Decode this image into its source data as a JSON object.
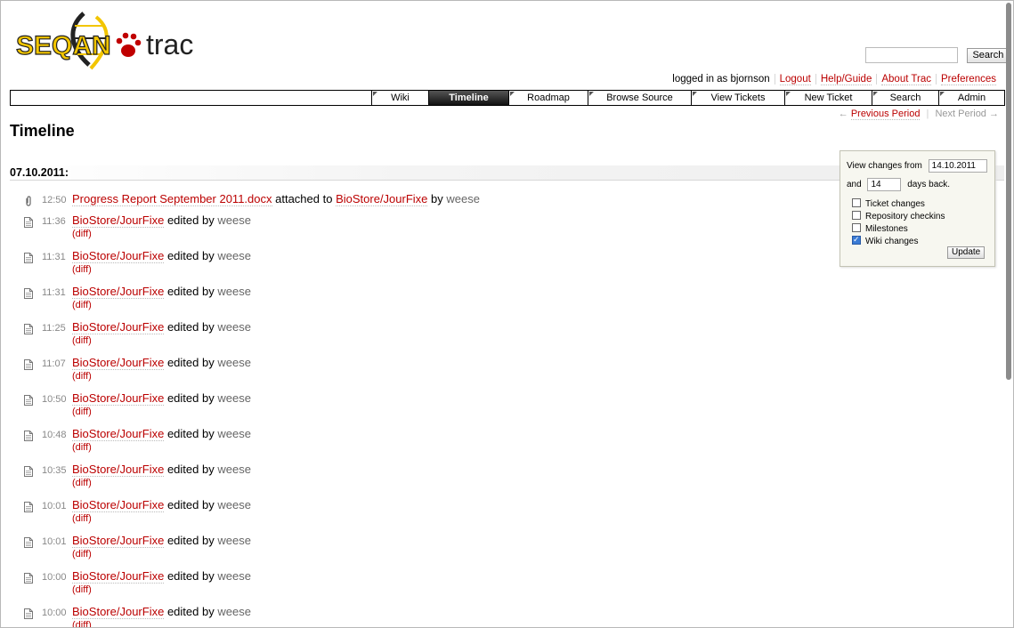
{
  "logo": {
    "text_left": "SEQAN",
    "text_right": "trac"
  },
  "search": {
    "placeholder": "",
    "button_label": "Search"
  },
  "metanav": {
    "logged_in": "logged in as bjornson",
    "items": [
      "Logout",
      "Help/Guide",
      "About Trac",
      "Preferences"
    ]
  },
  "mainnav": {
    "tabs": [
      {
        "label": "Wiki",
        "active": false
      },
      {
        "label": "Timeline",
        "active": true
      },
      {
        "label": "Roadmap",
        "active": false
      },
      {
        "label": "Browse Source",
        "active": false
      },
      {
        "label": "View Tickets",
        "active": false
      },
      {
        "label": "New Ticket",
        "active": false
      },
      {
        "label": "Search",
        "active": false
      },
      {
        "label": "Admin",
        "active": false
      }
    ]
  },
  "periodnav": {
    "prev_arrow": "←",
    "prev": "Previous Period",
    "next": "Next Period",
    "next_arrow": "→"
  },
  "page_title": "Timeline",
  "date_header": "07.10.2011:",
  "events": [
    {
      "type": "attachment",
      "time": "12:50",
      "link": "Progress Report September 2011.docx",
      "mid": "attached to",
      "target": "BioStore/JourFixe",
      "by": "by",
      "author": "weese"
    },
    {
      "type": "wiki",
      "time": "11:36",
      "link": "BioStore/JourFixe",
      "mid": "edited by",
      "author": "weese",
      "diff": "(diff)"
    },
    {
      "type": "wiki",
      "time": "11:31",
      "link": "BioStore/JourFixe",
      "mid": "edited by",
      "author": "weese",
      "diff": "(diff)"
    },
    {
      "type": "wiki",
      "time": "11:31",
      "link": "BioStore/JourFixe",
      "mid": "edited by",
      "author": "weese",
      "diff": "(diff)"
    },
    {
      "type": "wiki",
      "time": "11:25",
      "link": "BioStore/JourFixe",
      "mid": "edited by",
      "author": "weese",
      "diff": "(diff)"
    },
    {
      "type": "wiki",
      "time": "11:07",
      "link": "BioStore/JourFixe",
      "mid": "edited by",
      "author": "weese",
      "diff": "(diff)"
    },
    {
      "type": "wiki",
      "time": "10:50",
      "link": "BioStore/JourFixe",
      "mid": "edited by",
      "author": "weese",
      "diff": "(diff)"
    },
    {
      "type": "wiki",
      "time": "10:48",
      "link": "BioStore/JourFixe",
      "mid": "edited by",
      "author": "weese",
      "diff": "(diff)"
    },
    {
      "type": "wiki",
      "time": "10:35",
      "link": "BioStore/JourFixe",
      "mid": "edited by",
      "author": "weese",
      "diff": "(diff)"
    },
    {
      "type": "wiki",
      "time": "10:01",
      "link": "BioStore/JourFixe",
      "mid": "edited by",
      "author": "weese",
      "diff": "(diff)"
    },
    {
      "type": "wiki",
      "time": "10:01",
      "link": "BioStore/JourFixe",
      "mid": "edited by",
      "author": "weese",
      "diff": "(diff)"
    },
    {
      "type": "wiki",
      "time": "10:00",
      "link": "BioStore/JourFixe",
      "mid": "edited by",
      "author": "weese",
      "diff": "(diff)"
    },
    {
      "type": "wiki",
      "time": "10:00",
      "link": "BioStore/JourFixe",
      "mid": "edited by",
      "author": "weese",
      "diff": "(diff)"
    }
  ],
  "prefs": {
    "from_label": "View changes from",
    "from_value": "14.10.2011",
    "and_label": "and",
    "days_value": "14",
    "days_label": "days back.",
    "filters": [
      {
        "label": "Ticket changes",
        "checked": false
      },
      {
        "label": "Repository checkins",
        "checked": false
      },
      {
        "label": "Milestones",
        "checked": false
      },
      {
        "label": "Wiki changes",
        "checked": true
      }
    ],
    "update_label": "Update"
  },
  "colors": {
    "link": "#bb0000",
    "logo_yellow": "#f2c500",
    "logo_red": "#c00000"
  }
}
